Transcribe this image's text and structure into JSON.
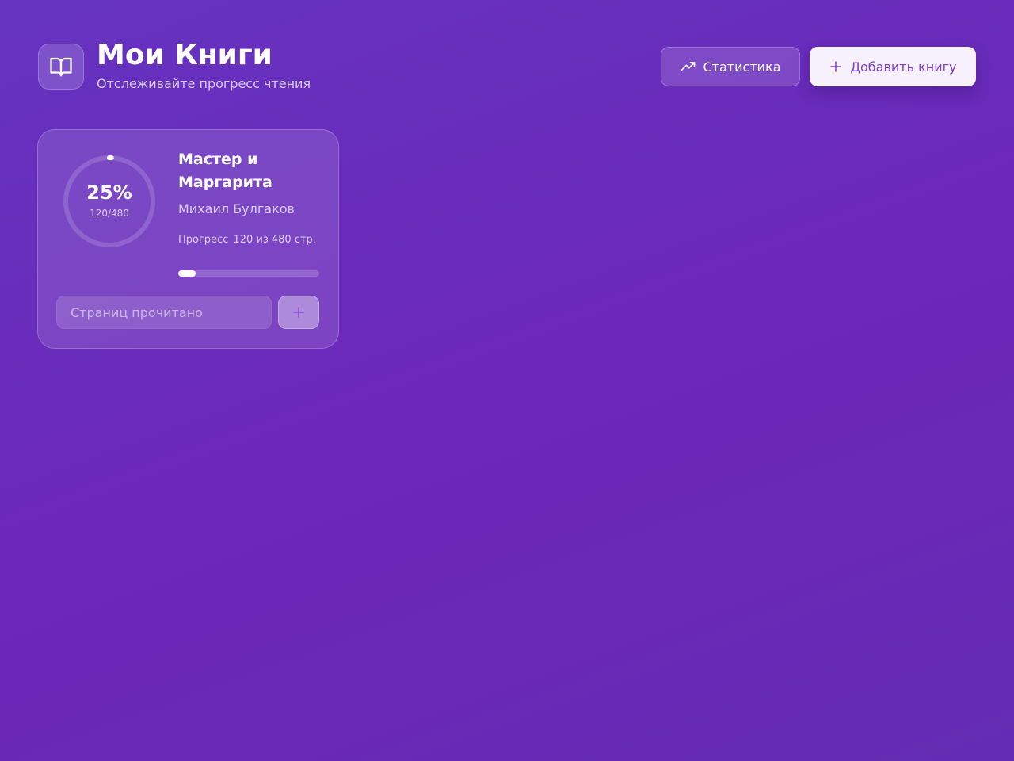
{
  "header": {
    "title": "Мои Книги",
    "subtitle": "Отслеживайте прогресс чтения",
    "app_icon": "open-book-icon",
    "stats_button": {
      "label": "Статистика",
      "icon": "trending-up-icon"
    },
    "add_button": {
      "label": "Добавить книгу",
      "icon": "plus-icon"
    }
  },
  "books": [
    {
      "title": "Мастер и Маргарита",
      "author": "Михаил Булгаков",
      "percent_label": "25%",
      "pages_label": "120/480",
      "progress_label": "Прогресс",
      "progress_value": "120 из 480 стр.",
      "pages_read": 120,
      "pages_total": 480,
      "progress_fraction": 0.125,
      "input_placeholder": "Страниц прочитано",
      "add_icon": "plus-icon"
    }
  ],
  "colors": {
    "background_start": "#6533c0",
    "background_end": "#642cb4",
    "accent": "#7b3fc4",
    "text": "#ffffff"
  }
}
